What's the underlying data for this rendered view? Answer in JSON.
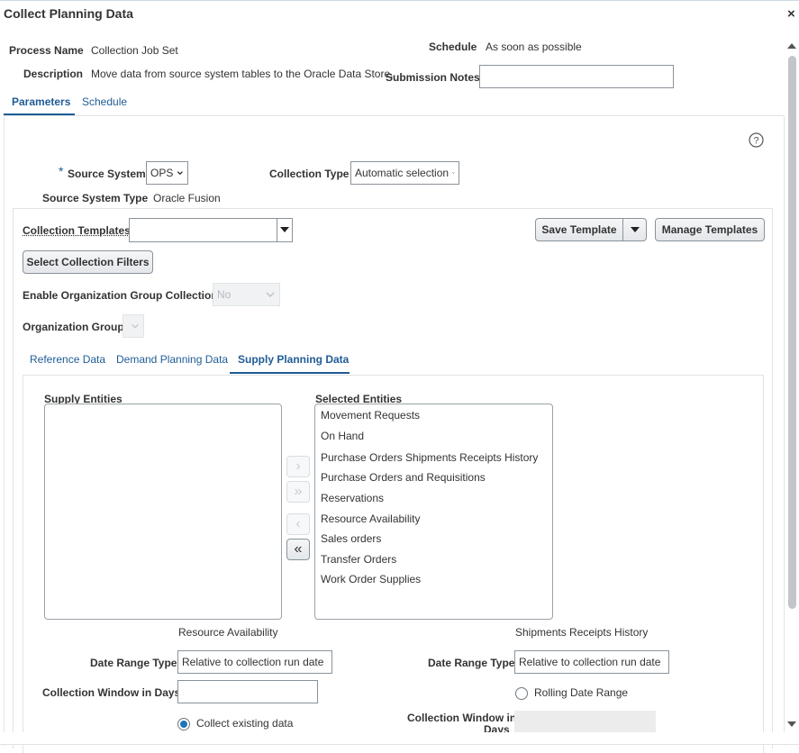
{
  "dialog": {
    "title": "Collect Planning Data",
    "close_glyph": "×"
  },
  "process": {
    "name_label": "Process Name",
    "name_value": "Collection Job Set",
    "description_label": "Description",
    "description_value": "Move data from source system tables to the Oracle Data Store.",
    "schedule_label": "Schedule",
    "schedule_value": "As soon as possible",
    "notes_label": "Submission Notes",
    "notes_value": ""
  },
  "top_tabs": [
    {
      "label": "Parameters",
      "active": true
    },
    {
      "label": "Schedule",
      "active": false
    }
  ],
  "help_icon": "?",
  "source": {
    "required_mark": "*",
    "system_label": "Source System",
    "system_value": "OPS",
    "collection_type_label": "Collection Type",
    "collection_type_value": "Automatic selection",
    "system_type_label": "Source System Type",
    "system_type_value": "Oracle Fusion"
  },
  "templates": {
    "label": "Collection Templates",
    "value": "",
    "save_button": "Save Template",
    "manage_button": "Manage Templates",
    "filters_button": "Select Collection Filters"
  },
  "org": {
    "enable_label": "Enable Organization Group Collection",
    "enable_value": "No",
    "group_label": "Organization Group",
    "group_value": ""
  },
  "data_tabs": [
    {
      "label": "Reference Data",
      "active": false
    },
    {
      "label": "Demand Planning Data",
      "active": false
    },
    {
      "label": "Supply Planning Data",
      "active": true
    }
  ],
  "shuttle": {
    "available_label": "Supply Entities",
    "selected_label": "Selected Entities",
    "available_items": [],
    "selected_items": [
      "Movement Requests",
      "On Hand",
      "Purchase Orders Shipments Receipts History",
      "Purchase Orders and Requisitions",
      "Reservations",
      "Resource Availability",
      "Sales orders",
      "Transfer Orders",
      "Work Order Supplies"
    ],
    "move_one": "›",
    "move_all": "»",
    "remove_one": "‹",
    "remove_all": "«"
  },
  "resource_availability": {
    "section_title": "Resource Availability",
    "date_range_label": "Date Range Type",
    "date_range_value": "Relative to collection run date",
    "window_label": "Collection Window in Days",
    "window_value": "",
    "collect_existing_label": "Collect existing data",
    "collect_existing_selected": true
  },
  "shipments_history": {
    "section_title": "Shipments Receipts History",
    "date_range_label": "Date Range Type",
    "date_range_value": "Relative to collection run date",
    "rolling_label": "Rolling Date Range",
    "rolling_selected": false,
    "window_label_line1": "Collection Window in",
    "window_label_line2": "Days",
    "window_value": ""
  },
  "colors": {
    "accent": "#1f5c96",
    "radio_on": "#1f73b7",
    "border": "#8a939a"
  }
}
